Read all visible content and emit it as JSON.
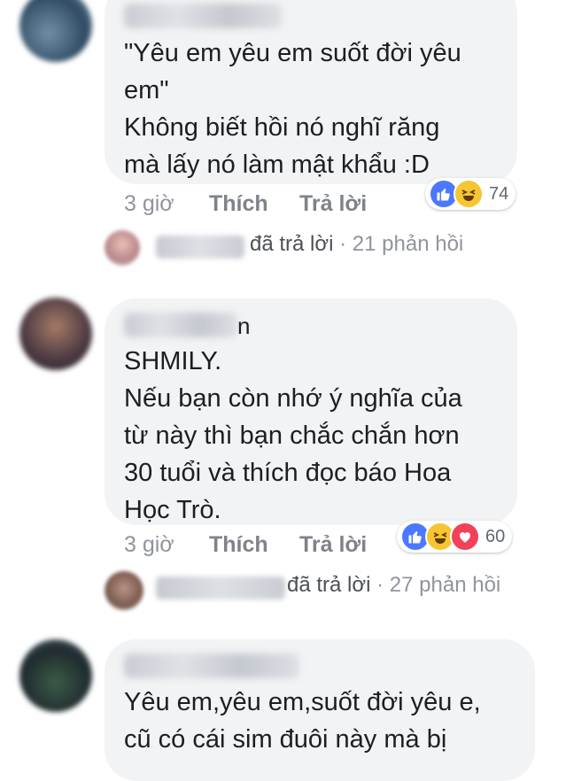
{
  "comments": [
    {
      "text": "\"Yêu em yêu em suốt đời yêu\nem\"\nKhông biết hồi nó nghĩ răng\nmà lấy nó làm mật khẩu :D",
      "time": "3 giờ",
      "like_label": "Thích",
      "reply_label": "Trả lời",
      "reaction_count": "74",
      "reactions": [
        "like-icon",
        "haha-icon"
      ],
      "replied_label": "đã trả lời",
      "reply_count": "21 phản hồi"
    },
    {
      "author_tail": "n",
      "text": "SHMILY.\nNếu bạn còn nhớ ý nghĩa của\ntừ này thì bạn chắc chắn hơn\n30 tuổi và thích đọc báo Hoa\nHọc Trò.",
      "time": "3 giờ",
      "like_label": "Thích",
      "reply_label": "Trả lời",
      "reaction_count": "60",
      "reactions": [
        "like-icon",
        "haha-icon",
        "love-icon"
      ],
      "replied_label": "đã trả lời",
      "reply_count": "27 phản hồi"
    },
    {
      "text": "Yêu em,yêu em,suốt đời yêu e,\ncũ có cái sim đuôi này mà bị"
    }
  ],
  "colors": {
    "bubble": "#f2f3f5",
    "like": "#4b78ff",
    "haha": "#f7c433",
    "love": "#f2415a",
    "meta": "#90949c"
  }
}
